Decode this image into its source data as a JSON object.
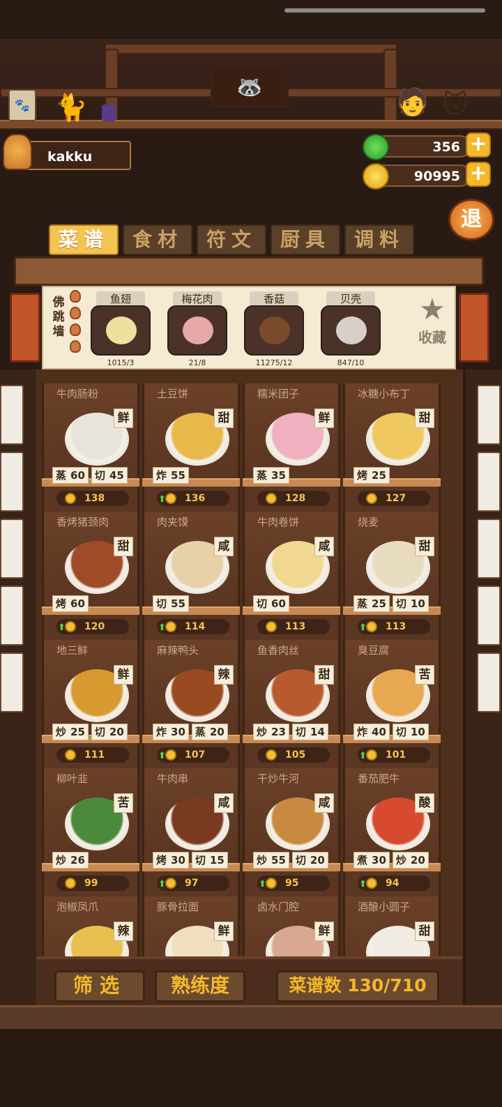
{
  "player": {
    "name": "kakku"
  },
  "currency": {
    "gems": "356",
    "coins": "90995"
  },
  "exit_label": "退",
  "tabs": [
    {
      "label": "菜谱",
      "active": true
    },
    {
      "label": "食材",
      "active": false
    },
    {
      "label": "符文",
      "active": false
    },
    {
      "label": "厨具",
      "active": false
    },
    {
      "label": "调料",
      "active": false
    }
  ],
  "selected_recipe": {
    "name": "佛跳墙",
    "ingredients": [
      {
        "name": "鱼翅",
        "count": "1015/3",
        "icon": "shark-fin-icon"
      },
      {
        "name": "梅花肉",
        "count": "21/8",
        "icon": "pork-icon"
      },
      {
        "name": "香菇",
        "count": "11275/12",
        "icon": "mushroom-icon"
      },
      {
        "name": "贝壳",
        "count": "847/10",
        "icon": "shell-icon"
      }
    ],
    "favorite_label": "收藏"
  },
  "recipes": [
    {
      "name": "牛肉肠粉",
      "taste": "鲜",
      "skills": [
        [
          "蒸",
          "60"
        ],
        [
          "切",
          "45"
        ]
      ],
      "price": "138",
      "up": false,
      "color": "#e8e4dc"
    },
    {
      "name": "土豆饼",
      "taste": "甜",
      "skills": [
        [
          "炸",
          "55"
        ]
      ],
      "price": "136",
      "up": true,
      "color": "#e8b84a"
    },
    {
      "name": "糯米团子",
      "taste": "鲜",
      "skills": [
        [
          "蒸",
          "35"
        ]
      ],
      "price": "128",
      "up": false,
      "color": "#f0b0c0"
    },
    {
      "name": "冰糖小布丁",
      "taste": "甜",
      "skills": [
        [
          "烤",
          "25"
        ]
      ],
      "price": "127",
      "up": false,
      "color": "#f0c860"
    },
    {
      "name": "香烤猪颈肉",
      "taste": "甜",
      "skills": [
        [
          "烤",
          "60"
        ]
      ],
      "price": "120",
      "up": true,
      "color": "#a04a28"
    },
    {
      "name": "肉夹馍",
      "taste": "咸",
      "skills": [
        [
          "切",
          "55"
        ]
      ],
      "price": "114",
      "up": true,
      "color": "#e8d0a8"
    },
    {
      "name": "牛肉卷饼",
      "taste": "咸",
      "skills": [
        [
          "切",
          "60"
        ]
      ],
      "price": "113",
      "up": false,
      "color": "#f0d890"
    },
    {
      "name": "烧麦",
      "taste": "甜",
      "skills": [
        [
          "蒸",
          "25"
        ],
        [
          "切",
          "10"
        ]
      ],
      "price": "113",
      "up": true,
      "color": "#e8dcc0"
    },
    {
      "name": "地三鲜",
      "taste": "鲜",
      "skills": [
        [
          "炒",
          "25"
        ],
        [
          "切",
          "20"
        ]
      ],
      "price": "111",
      "up": false,
      "color": "#d89a30"
    },
    {
      "name": "麻辣鸭头",
      "taste": "辣",
      "skills": [
        [
          "炸",
          "30"
        ],
        [
          "蒸",
          "20"
        ]
      ],
      "price": "107",
      "up": true,
      "color": "#9a4a20"
    },
    {
      "name": "鱼香肉丝",
      "taste": "甜",
      "skills": [
        [
          "炒",
          "23"
        ],
        [
          "切",
          "14"
        ]
      ],
      "price": "105",
      "up": false,
      "color": "#b85a30"
    },
    {
      "name": "臭豆腐",
      "taste": "苦",
      "skills": [
        [
          "炸",
          "40"
        ],
        [
          "切",
          "10"
        ]
      ],
      "price": "101",
      "up": true,
      "color": "#e8a850"
    },
    {
      "name": "柳叶韭",
      "taste": "苦",
      "skills": [
        [
          "炒",
          "26"
        ]
      ],
      "price": "99",
      "up": false,
      "color": "#4a8a3a"
    },
    {
      "name": "牛肉串",
      "taste": "咸",
      "skills": [
        [
          "烤",
          "30"
        ],
        [
          "切",
          "15"
        ]
      ],
      "price": "97",
      "up": true,
      "color": "#7a3a20"
    },
    {
      "name": "干炒牛河",
      "taste": "咸",
      "skills": [
        [
          "炒",
          "55"
        ],
        [
          "切",
          "20"
        ]
      ],
      "price": "95",
      "up": true,
      "color": "#c88a40"
    },
    {
      "name": "番茄肥牛",
      "taste": "酸",
      "skills": [
        [
          "煮",
          "30"
        ],
        [
          "炒",
          "20"
        ]
      ],
      "price": "94",
      "up": true,
      "color": "#d84a30"
    },
    {
      "name": "泡椒凤爪",
      "taste": "辣",
      "skills": [],
      "price": "",
      "up": false,
      "color": "#e8c050"
    },
    {
      "name": "豚骨拉面",
      "taste": "鲜",
      "skills": [],
      "price": "",
      "up": false,
      "color": "#f0e0c0"
    },
    {
      "name": "卤水门腔",
      "taste": "鲜",
      "skills": [],
      "price": "",
      "up": false,
      "color": "#d8a890"
    },
    {
      "name": "酒酿小圆子",
      "taste": "甜",
      "skills": [],
      "price": "",
      "up": false,
      "color": "#f0ece4"
    }
  ],
  "bottom": {
    "filter": "筛选",
    "proficiency": "熟练度",
    "recipe_count": "菜谱数 130/710"
  }
}
